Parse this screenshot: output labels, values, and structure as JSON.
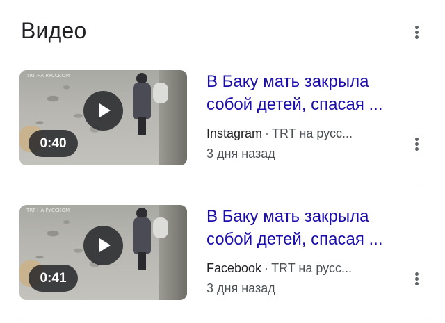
{
  "section": {
    "title": "Видео"
  },
  "videos": [
    {
      "title_line1": "В Баку мать закрыла",
      "title_line2": "собой детей, спасая ...",
      "duration": "0:40",
      "source": "Instagram",
      "separator": "·",
      "channel": "TRT на русс...",
      "date": "3 дня назад"
    },
    {
      "title_line1": "В Баку мать закрыла",
      "title_line2": "собой детей, спасая ...",
      "duration": "0:41",
      "source": "Facebook",
      "separator": "·",
      "channel": "TRT на русс...",
      "date": "3 дня назад"
    }
  ],
  "colors": {
    "link": "#1a0dab",
    "text": "#202124",
    "secondary": "#4d5156",
    "icon": "#5f6368",
    "divider": "#dadce0"
  },
  "icons": {
    "header_menu": "more-vert-icon",
    "item_menu": "more-vert-icon",
    "play": "play-icon"
  }
}
